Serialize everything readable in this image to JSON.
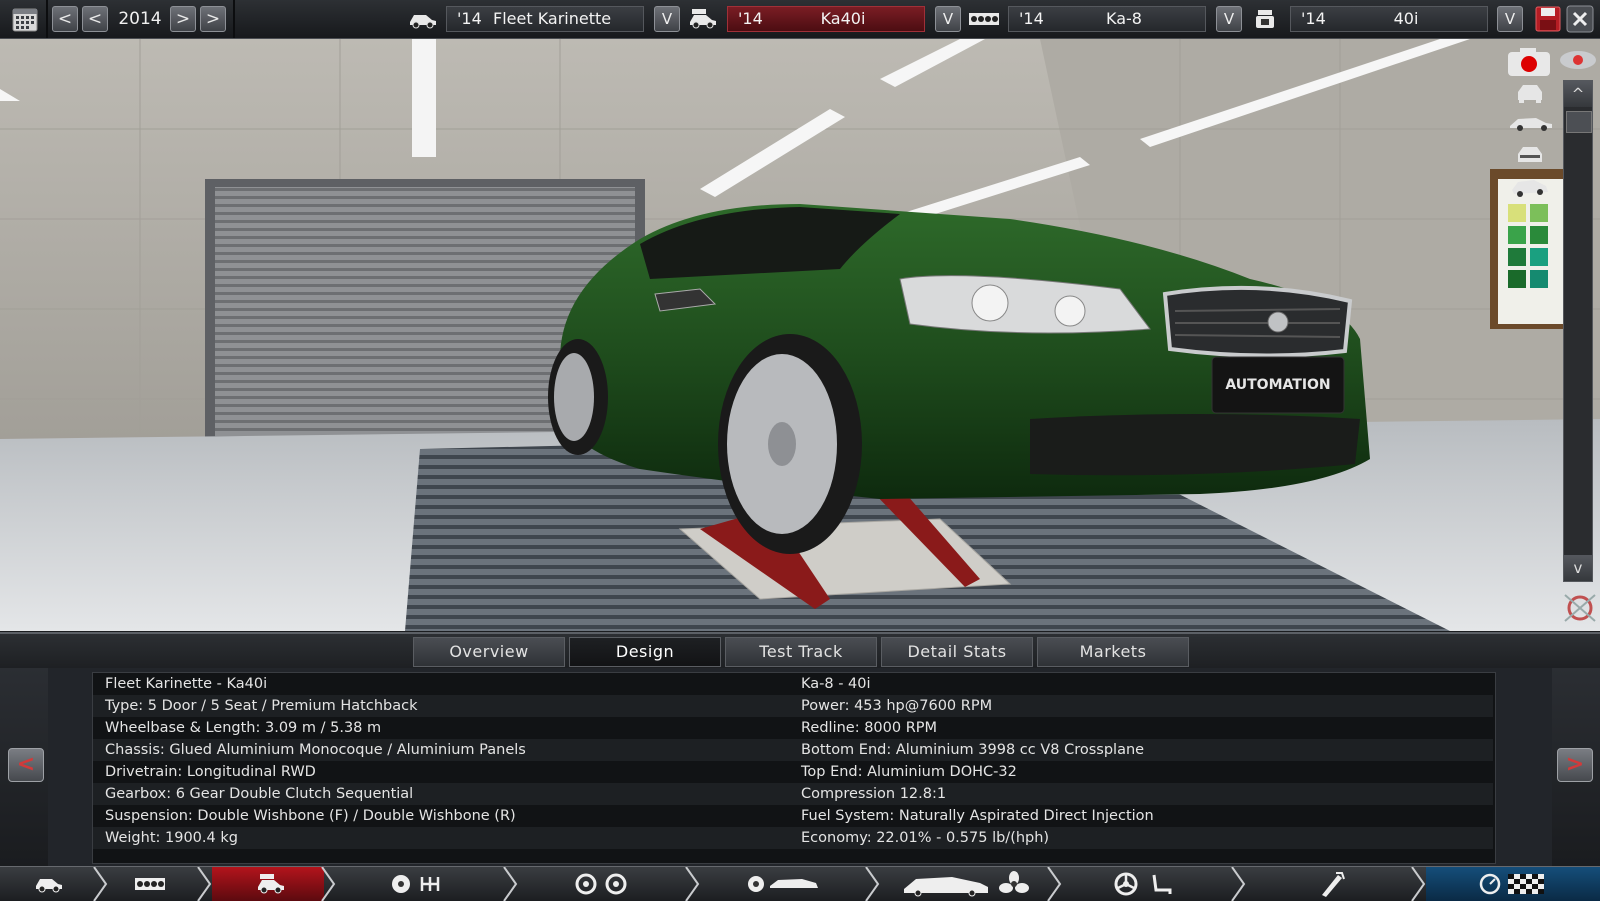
{
  "topbar": {
    "year": "2014",
    "prev_fast_label": "<",
    "prev_label": "<",
    "next_label": ">",
    "next_fast_label": ">",
    "dropdown_label": "V",
    "selectors": [
      {
        "year": "'14",
        "name": "Fleet Karinette",
        "icon": "car-platform-icon"
      },
      {
        "year": "'14",
        "name": "Ka40i",
        "icon": "car-trim-icon"
      },
      {
        "year": "'14",
        "name": "Ka-8",
        "icon": "engine-block-icon"
      },
      {
        "year": "'14",
        "name": "40i",
        "icon": "engine-variant-icon"
      }
    ],
    "save_icon": "save-icon",
    "close_icon": "close-icon",
    "calendar_icon": "calendar-icon"
  },
  "viewport": {
    "badge_text": "AUTOMATION",
    "car_color": "#1f4d1d",
    "scroll_up_label": "^",
    "scroll_down_label": "v"
  },
  "tabs": [
    {
      "label": "Overview",
      "active": false
    },
    {
      "label": "Design",
      "active": true
    },
    {
      "label": "Test Track",
      "active": false
    },
    {
      "label": "Detail Stats",
      "active": false
    },
    {
      "label": "Markets",
      "active": false
    }
  ],
  "info": {
    "prev_label": "<",
    "next_label": ">",
    "left": [
      "Fleet Karinette - Ka40i",
      "Type: 5 Door / 5 Seat / Premium Hatchback",
      "Wheelbase & Length: 3.09 m / 5.38 m",
      "Chassis: Glued Aluminium Monocoque / Aluminium Panels",
      "Drivetrain: Longitudinal RWD",
      "Gearbox: 6 Gear Double Clutch Sequential",
      "Suspension: Double Wishbone (F) / Double Wishbone (R)",
      "Weight: 1900.4 kg"
    ],
    "right": [
      "Ka-8 - 40i",
      "Power: 453 hp@7600 RPM",
      "Redline: 8000 RPM",
      "Bottom End: Aluminium 3998 cc V8 Crossplane",
      "Top End: Aluminium DOHC-32",
      "Compression 12.8:1",
      "Fuel System: Naturally Aspirated Direct Injection",
      "Economy: 22.01% - 0.575 lb/(hph)"
    ]
  },
  "bottomnav": {
    "segments": [
      {
        "icon": "car-model-icon",
        "active": false
      },
      {
        "icon": "engine-icon",
        "active": false
      },
      {
        "icon": "trim-icon",
        "active": true
      },
      {
        "icon": "gearbox-icon",
        "active": false
      },
      {
        "icon": "wheels-icon",
        "active": false
      },
      {
        "icon": "body-design-icon",
        "active": false
      },
      {
        "icon": "aero-cooling-icon",
        "active": false
      },
      {
        "icon": "interior-icon",
        "active": false
      },
      {
        "icon": "tuning-icon",
        "active": false
      },
      {
        "icon": "test-track-icon",
        "active": false
      }
    ],
    "accent": "#b3141c"
  }
}
